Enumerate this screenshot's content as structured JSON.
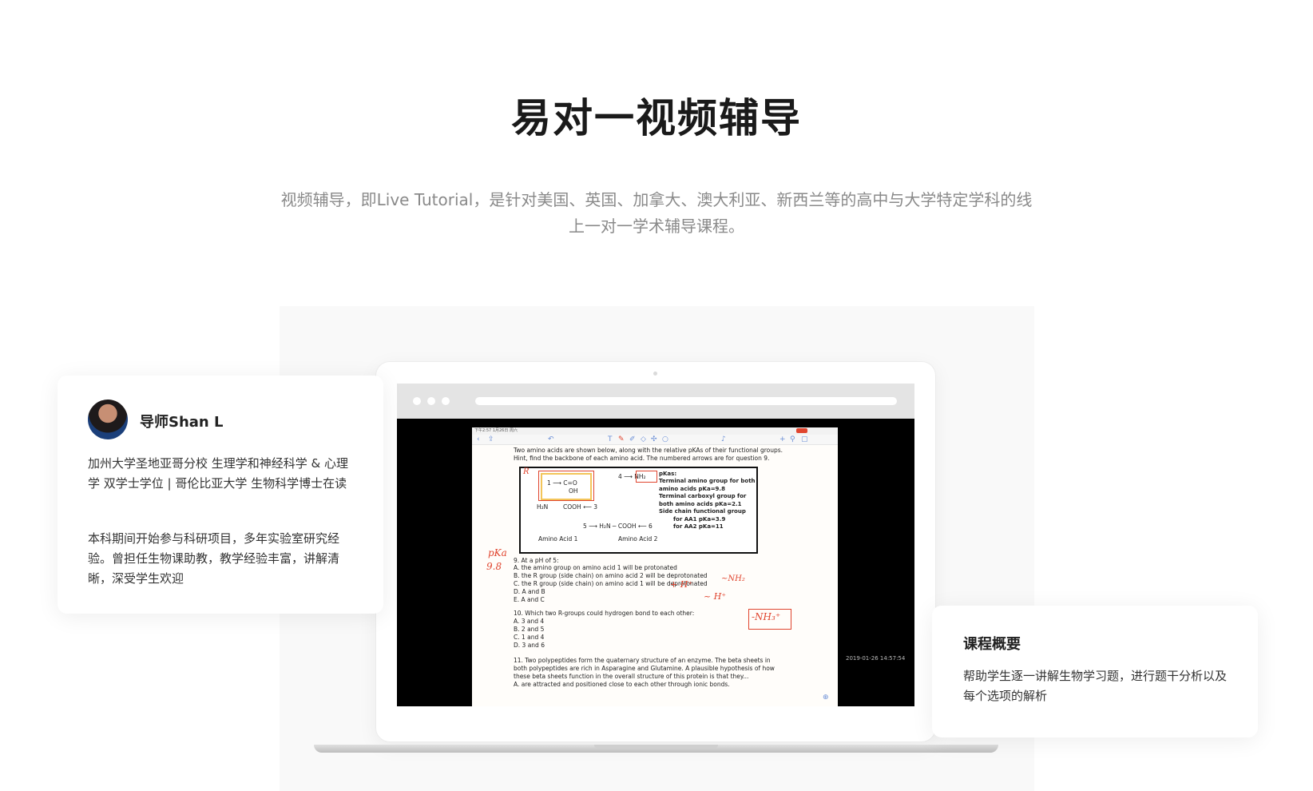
{
  "header": {
    "title": "易对一视频辅导",
    "description": "视频辅导，即Live Tutorial，是针对美国、英国、加拿大、澳大利亚、新西兰等的高中与大学特定学科的线上一对一学术辅导课程。"
  },
  "tutor": {
    "name": "导师Shan L",
    "education": "加州大学圣地亚哥分校 生理学和神经科学 & 心理学 双学士学位 | 哥伦比亚大学 生物科学博士在读",
    "experience": "本科期间开始参与科研项目，多年实验室研究经验。曾担任生物课助教，教学经验丰富，讲解清晰，深受学生欢迎"
  },
  "course": {
    "title": "课程概要",
    "description": "帮助学生逐一讲解生物学习题，进行题干分析以及每个选项的解析"
  },
  "screenshot": {
    "status_time": "下午2:57  1月26日 周六",
    "battery": "66%",
    "timestamp": "2019-01-26 14:57:54",
    "intro_lines": [
      "Two amino acids are shown below, along with the relative pKAs of their functional groups.",
      "Hint, find the backbone of each amino acid. The numbered arrows are for question 9."
    ],
    "pkas": [
      "pKas:",
      "Terminal amino group for both",
      "amino acids pKa=9.8",
      "Terminal carboxyl group for",
      "both amino acids pKa=2.1",
      "Side chain functional group",
      "for AA1 pKa=3.9",
      "for AA2 pKa=11"
    ],
    "amino1_label": "Amino Acid 1",
    "amino2_label": "Amino Acid 2",
    "q9": [
      "9.  At a pH of 5:",
      "A. the amino group on amino acid 1 will be protonated",
      "B. the R group (side chain) on amino acid 2 will be deprotonated",
      "C. the R group (side chain) on amino acid 1 will be deprotonated",
      "D. A and B",
      "E. A and C"
    ],
    "q10": [
      "10. Which two R-groups could hydrogen bond to each other:",
      "A. 3 and 4",
      "B. 2 and 5",
      "C. 1 and 4",
      "D. 3 and 6"
    ],
    "q11": [
      "11.  Two polypeptides form the quaternary structure of an enzyme. The beta sheets in",
      "both polypeptides are rich in Asparagine and Glutamine. A plausible hypothesis of how",
      "these beta sheets function in the overall structure of this protein is that they...",
      "    A.  are attracted and positioned close to each other through ionic bonds."
    ],
    "annotations": {
      "r": "R",
      "pka": "pKa",
      "pka_val": "9.8",
      "hplus1": "+ H⁺",
      "hplus2": "~ H⁺",
      "nh2": "~NH₂",
      "nh3": "-NH₃⁺"
    }
  }
}
